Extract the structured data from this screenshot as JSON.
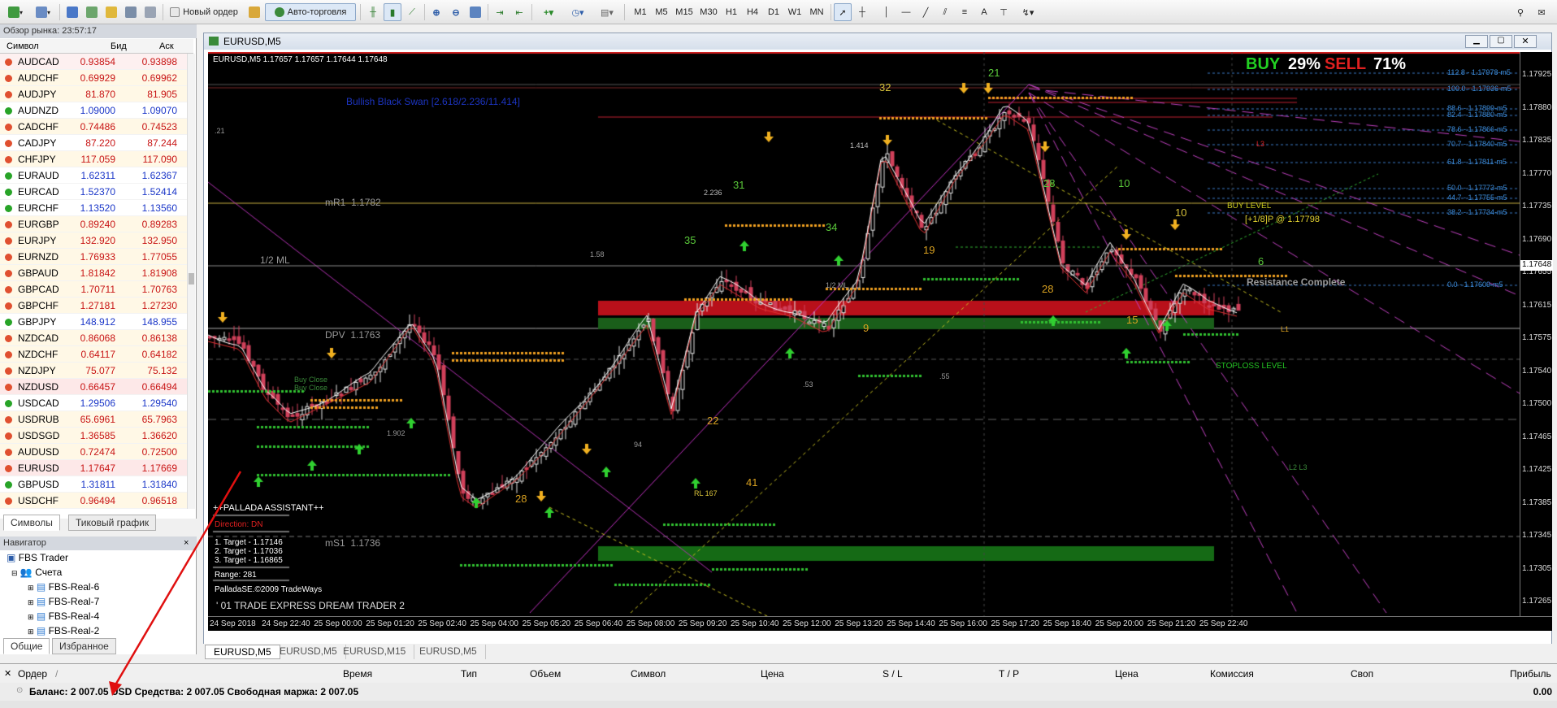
{
  "toolbar": {
    "new_order": "Новый ордер",
    "autotrading": "Авто-торговля",
    "timeframes": [
      "M1",
      "M5",
      "M15",
      "M30",
      "H1",
      "H4",
      "D1",
      "W1",
      "MN"
    ],
    "tool_text": "A"
  },
  "market_watch": {
    "title": "Обзор рынка: 23:57:17",
    "col_symbol": "Символ",
    "col_bid": "Бид",
    "col_ask": "Аск",
    "rows": [
      {
        "symbol": "AUDCAD",
        "bid": "0.93854",
        "ask": "0.93898",
        "dir": "dn",
        "bg": "#fdf0f0"
      },
      {
        "symbol": "AUDCHF",
        "bid": "0.69929",
        "ask": "0.69962",
        "dir": "dn",
        "bg": "#fff8e6"
      },
      {
        "symbol": "AUDJPY",
        "bid": "81.870",
        "ask": "81.905",
        "dir": "dn",
        "bg": "#fff8e6"
      },
      {
        "symbol": "AUDNZD",
        "bid": "1.09000",
        "ask": "1.09070",
        "dir": "up",
        "bg": "#ffffff"
      },
      {
        "symbol": "CADCHF",
        "bid": "0.74486",
        "ask": "0.74523",
        "dir": "dn",
        "bg": "#fff8e6"
      },
      {
        "symbol": "CADJPY",
        "bid": "87.220",
        "ask": "87.244",
        "dir": "dn",
        "bg": "#ffffff"
      },
      {
        "symbol": "CHFJPY",
        "bid": "117.059",
        "ask": "117.090",
        "dir": "dn",
        "bg": "#fff8e6"
      },
      {
        "symbol": "EURAUD",
        "bid": "1.62311",
        "ask": "1.62367",
        "dir": "up",
        "bg": "#ffffff"
      },
      {
        "symbol": "EURCAD",
        "bid": "1.52370",
        "ask": "1.52414",
        "dir": "up",
        "bg": "#ffffff"
      },
      {
        "symbol": "EURCHF",
        "bid": "1.13520",
        "ask": "1.13560",
        "dir": "up",
        "bg": "#ffffff"
      },
      {
        "symbol": "EURGBP",
        "bid": "0.89240",
        "ask": "0.89283",
        "dir": "dn",
        "bg": "#fff8e6"
      },
      {
        "symbol": "EURJPY",
        "bid": "132.920",
        "ask": "132.950",
        "dir": "dn",
        "bg": "#fff8e6"
      },
      {
        "symbol": "EURNZD",
        "bid": "1.76933",
        "ask": "1.77055",
        "dir": "dn",
        "bg": "#fff8e6"
      },
      {
        "symbol": "GBPAUD",
        "bid": "1.81842",
        "ask": "1.81908",
        "dir": "dn",
        "bg": "#fff8e6"
      },
      {
        "symbol": "GBPCAD",
        "bid": "1.70711",
        "ask": "1.70763",
        "dir": "dn",
        "bg": "#fff8e6"
      },
      {
        "symbol": "GBPCHF",
        "bid": "1.27181",
        "ask": "1.27230",
        "dir": "dn",
        "bg": "#fff8e6"
      },
      {
        "symbol": "GBPJPY",
        "bid": "148.912",
        "ask": "148.955",
        "dir": "up",
        "bg": "#ffffff"
      },
      {
        "symbol": "NZDCAD",
        "bid": "0.86068",
        "ask": "0.86138",
        "dir": "dn",
        "bg": "#fff8e6"
      },
      {
        "symbol": "NZDCHF",
        "bid": "0.64117",
        "ask": "0.64182",
        "dir": "dn",
        "bg": "#fff8e6"
      },
      {
        "symbol": "NZDJPY",
        "bid": "75.077",
        "ask": "75.132",
        "dir": "dn",
        "bg": "#fff8e6"
      },
      {
        "symbol": "NZDUSD",
        "bid": "0.66457",
        "ask": "0.66494",
        "dir": "dn",
        "bg": "#fde8e8"
      },
      {
        "symbol": "USDCAD",
        "bid": "1.29506",
        "ask": "1.29540",
        "dir": "up",
        "bg": "#ffffff"
      },
      {
        "symbol": "USDRUB",
        "bid": "65.6961",
        "ask": "65.7963",
        "dir": "dn",
        "bg": "#fff8e6"
      },
      {
        "symbol": "USDSGD",
        "bid": "1.36585",
        "ask": "1.36620",
        "dir": "dn",
        "bg": "#fff8e6"
      },
      {
        "symbol": "AUDUSD",
        "bid": "0.72474",
        "ask": "0.72500",
        "dir": "dn",
        "bg": "#fff8e6"
      },
      {
        "symbol": "EURUSD",
        "bid": "1.17647",
        "ask": "1.17669",
        "dir": "dn",
        "bg": "#fde8e8"
      },
      {
        "symbol": "GBPUSD",
        "bid": "1.31811",
        "ask": "1.31840",
        "dir": "up",
        "bg": "#ffffff"
      },
      {
        "symbol": "USDCHF",
        "bid": "0.96494",
        "ask": "0.96518",
        "dir": "dn",
        "bg": "#fff8e6"
      }
    ],
    "tab_symbols": "Символы",
    "tab_tick": "Тиковый график"
  },
  "navigator": {
    "title": "Навигатор",
    "root": "FBS Trader",
    "accounts": "Счета",
    "items": [
      "FBS-Real-6",
      "FBS-Real-7",
      "FBS-Real-4",
      "FBS-Real-2"
    ],
    "tab_common": "Общие",
    "tab_fav": "Избранное"
  },
  "chart": {
    "window_title": "EURUSD,M5",
    "info_line": "EURUSD,M5  1.17657 1.17657 1.17644 1.17648",
    "buy_label": "BUY",
    "buy_pct": "29%",
    "sell_label": "SELL",
    "sell_pct": "71%",
    "pattern_label": "Bullish Black Swan [2.618/2.236/11.414]",
    "mR1_label": "mR1",
    "mR1_value": "1.1782",
    "dpv_label": "DPV",
    "dpv_value": "1.1763",
    "ms1_label": "mS1",
    "ms1_value": "1.1736",
    "half_ml": "1/2 ML",
    "buy_level": "BUY LEVEL",
    "buy_level_note": "[+1/8]P @ 1.17798",
    "resistance": "Resistance Complete",
    "stoploss": "STOPLOSS LEVEL",
    "assistant": {
      "title": "++PALLADA ASSISTANT++",
      "direction": "Direction: DN",
      "targets": [
        "1. Target - 1.17146",
        "2. Target - 1.17036",
        "3. Target - 1.16865"
      ],
      "range": "Range: 281",
      "copyright": "PalladaSE.©2009 TradeWays",
      "trade_line": "' 01 TRADE EXPRESS DREAM TRADER 2"
    },
    "fib_labels": [
      "112.8 - 1.17978-m5",
      "100.0 - 1.17936-m5",
      "88.6 - 1.17899-m5",
      "82.4 - 1.17880-m5",
      "78.6 - 1.17866-m5",
      "70.7 - 1.17840-m5",
      "61.8 - 1.17811-m5",
      "50.0 - 1.17773-m5",
      "44.7 - 1.17755-m5",
      "38.2 - 1.17734-m5",
      "0.0 - 1.17609-m5"
    ],
    "wave_numbers": [
      "21",
      "32",
      "31",
      "35",
      "34",
      "19",
      "28",
      "9",
      "22",
      "10",
      "10",
      "6",
      "28",
      "15",
      "41",
      "28"
    ],
    "price_ticks": [
      "1.17925",
      "1.17880",
      "1.17835",
      "1.17770",
      "1.17735",
      "1.17690",
      "1.17655",
      "1.17615",
      "1.17575",
      "1.17540",
      "1.17500",
      "1.17465",
      "1.17425",
      "1.17385",
      "1.17345",
      "1.17305",
      "1.17265"
    ],
    "current_price": "1.17648",
    "time_ticks": [
      "24 Sep 2018",
      "24 Sep 22:40",
      "25 Sep 00:00",
      "25 Sep 01:20",
      "25 Sep 02:40",
      "25 Sep 04:00",
      "25 Sep 05:20",
      "25 Sep 06:40",
      "25 Sep 08:00",
      "25 Sep 09:20",
      "25 Sep 10:40",
      "25 Sep 12:00",
      "25 Sep 13:20",
      "25 Sep 14:40",
      "25 Sep 16:00",
      "25 Sep 17:20",
      "25 Sep 18:40",
      "25 Sep 20:00",
      "25 Sep 21:20",
      "25 Sep 22:40"
    ],
    "misc_labels": [
      "2.236",
      "1.414",
      "1.902",
      ".21",
      ".53",
      ".55",
      "94",
      "1.58",
      "RL 167",
      "1/2 ML",
      "L3",
      "L1",
      "L2 L3",
      "Buy Close",
      "Buy Close"
    ],
    "colors": {
      "bg": "#000000",
      "up": "#e6e6e6",
      "down": "#d0405a",
      "red_zone": "#c0101a",
      "green_zone": "#1a6e1a",
      "yellow_line": "#e0c040",
      "magenta": "#c030c0"
    }
  },
  "chart_tabs": [
    "EURUSD,M5",
    "EURUSD,M5",
    "EURUSD,M15",
    "EURUSD,M5"
  ],
  "terminal": {
    "col_order": "Ордер",
    "col_slash": "/",
    "col_time": "Время",
    "col_type": "Тип",
    "col_volume": "Объем",
    "col_symbol": "Символ",
    "col_price": "Цена",
    "col_sl": "S / L",
    "col_tp": "T / P",
    "col_price2": "Цена",
    "col_commission": "Комиссия",
    "col_swap": "Своп",
    "col_profit": "Прибыль",
    "balance_line": "Баланс: 2 007.05 USD  Средства: 2 007.05  Свободная маржа: 2 007.05",
    "profit_value": "0.00"
  }
}
